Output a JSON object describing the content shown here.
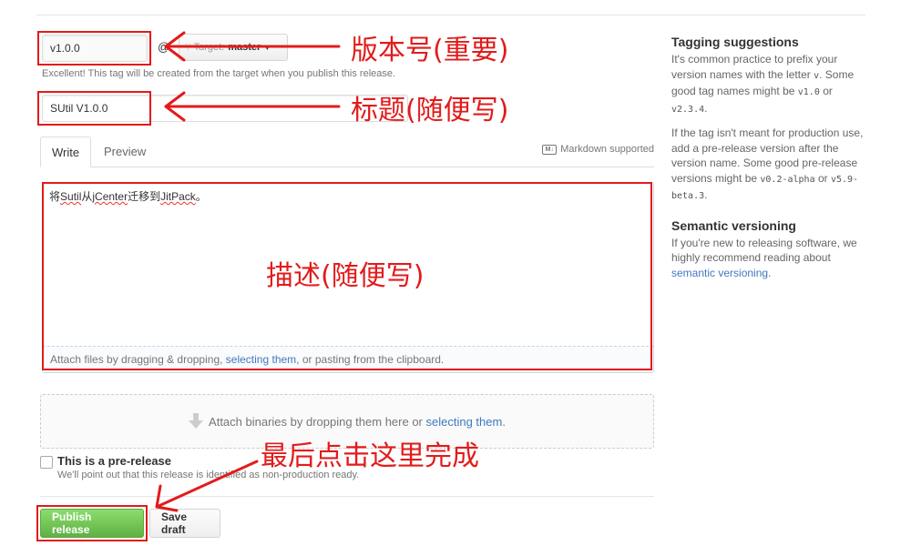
{
  "form": {
    "tag_value": "v1.0.0",
    "at_symbol": "@",
    "target_prefix": "Target:",
    "target_branch": "master",
    "tag_hint": "Excellent! This tag will be created from the target when you publish this release.",
    "title_value": "SUtil V1.0.0",
    "tabs": [
      "Write",
      "Preview"
    ],
    "markdown_icon": "markdown-icon",
    "markdown_label": "Markdown supported",
    "description_prefix": "将",
    "description_word1": "Sutil",
    "description_middle": "从",
    "description_word2": "jCenter",
    "description_middle2": "迁移到",
    "description_word3": "JitPack",
    "description_suffix": "。",
    "attach_prefix": "Attach files by dragging & dropping, ",
    "attach_link": "selecting them",
    "attach_suffix": ", or pasting from the clipboard.",
    "binaries_prefix": "Attach binaries by dropping them here or ",
    "binaries_link": "selecting them",
    "binaries_suffix": ".",
    "prerelease_label": "This is a pre-release",
    "prerelease_note": "We'll point out that this release is identified as non-production ready.",
    "publish_label": "Publish release",
    "draft_label": "Save draft"
  },
  "sidebar": {
    "tagging_title": "Tagging suggestions",
    "tagging_p1a": "It's common practice to prefix your version names with the letter ",
    "tagging_p1_code1": "v",
    "tagging_p1b": ". Some good tag names might be ",
    "tagging_p1_code2": "v1.0",
    "tagging_p1c": " or ",
    "tagging_p1_code3": "v2.3.4",
    "tagging_p1d": ".",
    "tagging_p2a": "If the tag isn't meant for production use, add a pre-release version after the version name. Some good pre-release versions might be ",
    "tagging_p2_code1": "v0.2-alpha",
    "tagging_p2b": " or ",
    "tagging_p2_code2": "v5.9-beta.3",
    "tagging_p2c": ".",
    "semver_title": "Semantic versioning",
    "semver_p": "If you're new to releasing software, we highly recommend reading about ",
    "semver_link": "semantic versioning",
    "semver_end": "."
  },
  "annotations": {
    "version": "版本号(重要)",
    "title": "标题(随便写)",
    "description": "描述(随便写)",
    "publish": "最后点击这里完成"
  },
  "colors": {
    "annotation_red": "#e21b1b",
    "publish_green": "#60b044",
    "link_blue": "#4078c0"
  }
}
